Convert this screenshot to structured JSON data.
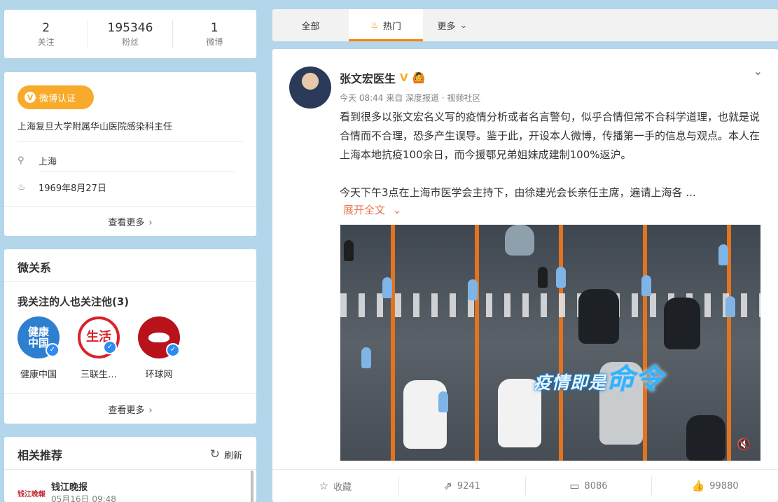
{
  "stats": [
    {
      "value": "2",
      "label": "关注"
    },
    {
      "value": "195346",
      "label": "粉丝"
    },
    {
      "value": "1",
      "label": "微博"
    }
  ],
  "profile": {
    "verify_label": "微博认证",
    "verify_desc": "上海复旦大学附属华山医院感染科主任",
    "location": "上海",
    "birthday": "1969年8月27日",
    "more": "查看更多"
  },
  "relations": {
    "title": "微关系",
    "subtitle": "我关注的人也关注他(3)",
    "items": [
      {
        "name": "健康中国",
        "avatar_text": "健康中国",
        "color": "#2f7fd1"
      },
      {
        "name": "三联生…",
        "avatar_text": "生活",
        "color": "#d8232a"
      },
      {
        "name": "环球网",
        "avatar_text": "",
        "color": "#b8121b"
      }
    ],
    "more": "查看更多"
  },
  "recommend": {
    "title": "相关推荐",
    "refresh": "刷新",
    "item": {
      "logo": "钱江晚報",
      "name": "钱江晚报",
      "time": "05月16日 09:48"
    }
  },
  "tabs": [
    {
      "label": "全部"
    },
    {
      "label": "热门"
    },
    {
      "label": "更多"
    }
  ],
  "post": {
    "author": "张文宏医生",
    "meta": "今天 08:44 来自 深度报道 · 视频社区",
    "text": "看到很多以张文宏名义写的疫情分析或者名言警句，似乎合情但常不合科学道理，也就是说合情而不合理，恐多产生误导。鉴于此，开设本人微博，传播第一手的信息与观点。本人在上海本地抗疫100余日，而今援鄂兄弟姐妹成建制100%返沪。",
    "text2": "今天下午3点在上海市医学会主持下，由徐建光会长亲任主席，遍请上海各 ...",
    "expand": "展开全文",
    "video_caption_small": "疫情即是",
    "video_caption_big": "命令",
    "actions": [
      {
        "label": "收藏",
        "icon": "star-icon"
      },
      {
        "label": "9241",
        "icon": "share-icon"
      },
      {
        "label": "8086",
        "icon": "comment-icon"
      },
      {
        "label": "99880",
        "icon": "like-icon"
      }
    ]
  }
}
